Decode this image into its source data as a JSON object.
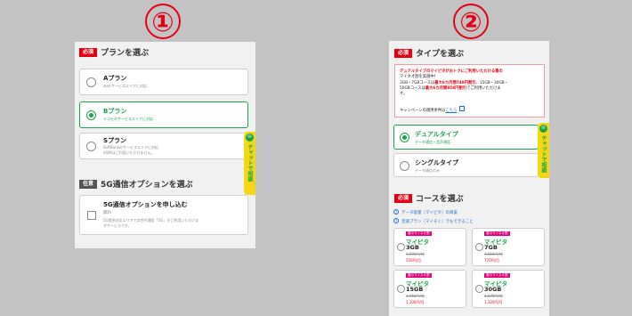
{
  "markers": {
    "one": "①",
    "two": "②"
  },
  "left": {
    "plan_section": {
      "required": "必須",
      "title": "プランを選ぶ"
    },
    "plans": [
      {
        "name": "Aプラン",
        "desc1": "auのサービスエリアに対応",
        "desc2": "",
        "selected": false
      },
      {
        "name": "Bプラン",
        "desc1": "ドコモのサービスエリアに対応",
        "desc2": "",
        "selected": true
      },
      {
        "name": "Sプラン",
        "desc1": "SoftBankのサービスエリアに対応",
        "desc2": "eSIMはご利用いただけません。",
        "selected": false
      }
    ],
    "option_section": {
      "tag": "任意",
      "title": "5G通信オプションを選ぶ"
    },
    "option": {
      "name": "5G通信オプションを申し込む",
      "fee": "無料",
      "desc1": "5G提供対応エリアで次世代通信「5G」がご利用いただけま",
      "desc2": "すサービスです。"
    },
    "chat": {
      "text": "チャットで相談"
    }
  },
  "right": {
    "type_section": {
      "required": "必須",
      "title": "タイプを選ぶ"
    },
    "notice": {
      "line1": "デュアルタイプのマイピタがおトクにご利用いただける春の",
      "line2": "マイネオ割を実施中！",
      "line3a": "3GB・7GBコースは",
      "line3b": "最大6カ月間748円割引",
      "line3c": "、15GB・30GB・",
      "line4a": "50GBコースは",
      "line4b": "最大6カ月間858円割引",
      "line4c": "でご利用いただけま",
      "line5": "す。",
      "link_prefix": "キャンペーンの適用条件は",
      "link_text": "こちら"
    },
    "types": [
      {
        "name": "デュアルタイプ",
        "desc": "データ通信＋音声通話",
        "selected": true
      },
      {
        "name": "シングルタイプ",
        "desc": "データ通信のみ",
        "selected": false
      }
    ],
    "course_section": {
      "required": "必須",
      "title": "コースを選ぶ"
    },
    "links": [
      "データ容量（マイピタ）の目安",
      "音速プラン（マイそく）でもできること"
    ],
    "courses": [
      {
        "badge": "春のマイネオ割",
        "name": "マイピタ",
        "size": "3GB",
        "old_price": "1,298円/月",
        "price": "550円/月"
      },
      {
        "badge": "春のマイネオ割",
        "name": "マイピタ",
        "size": "7GB",
        "old_price": "1,518円/月",
        "price": "770円/月"
      },
      {
        "badge": "春のマイネオ割",
        "name": "マイピタ",
        "size": "15GB",
        "old_price": "1,958円/月",
        "price": "1,100円/月"
      },
      {
        "badge": "春のマイネオ割",
        "name": "マイピタ",
        "size": "30GB",
        "old_price": "2,178円/月",
        "price": "1,320円/月"
      }
    ],
    "chat": {
      "text": "チャットで相談"
    }
  }
}
